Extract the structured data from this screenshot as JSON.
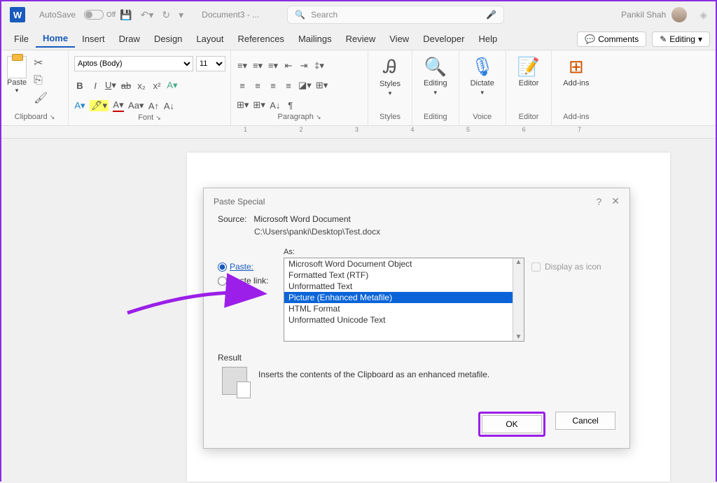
{
  "titlebar": {
    "autosave": "AutoSave",
    "autosave_state": "Off",
    "doc_name": "Document3 - ...",
    "search_placeholder": "Search",
    "user_name": "Pankil Shah"
  },
  "menu": {
    "file": "File",
    "home": "Home",
    "insert": "Insert",
    "draw": "Draw",
    "design": "Design",
    "layout": "Layout",
    "references": "References",
    "mailings": "Mailings",
    "review": "Review",
    "view": "View",
    "developer": "Developer",
    "help": "Help",
    "comments": "Comments",
    "editing": "Editing"
  },
  "ribbon": {
    "clipboard": {
      "label": "Clipboard",
      "paste": "Paste"
    },
    "font": {
      "label": "Font",
      "family": "Aptos (Body)",
      "size": "11"
    },
    "paragraph": {
      "label": "Paragraph"
    },
    "styles": {
      "label": "Styles",
      "btn": "Styles"
    },
    "editing": {
      "label": "Editing",
      "btn": "Editing"
    },
    "voice": {
      "label": "Voice",
      "btn": "Dictate"
    },
    "editor": {
      "label": "Editor",
      "btn": "Editor"
    },
    "addins": {
      "label": "Add-ins",
      "btn": "Add-ins"
    }
  },
  "ruler": [
    "1",
    "2",
    "3",
    "4",
    "5",
    "6",
    "7"
  ],
  "dialog": {
    "title": "Paste Special",
    "source_label": "Source:",
    "source_name": "Microsoft Word Document",
    "source_path": "C:\\Users\\panki\\Desktop\\Test.docx",
    "paste_label": "Paste:",
    "paste_link_label": "Paste link:",
    "as_label": "As:",
    "options": [
      "Microsoft Word Document Object",
      "Formatted Text (RTF)",
      "Unformatted Text",
      "Picture (Enhanced Metafile)",
      "HTML Format",
      "Unformatted Unicode Text"
    ],
    "selected_index": 3,
    "display_icon": "Display as icon",
    "result_label": "Result",
    "result_text": "Inserts the contents of the Clipboard as an enhanced metafile.",
    "ok": "OK",
    "cancel": "Cancel"
  }
}
